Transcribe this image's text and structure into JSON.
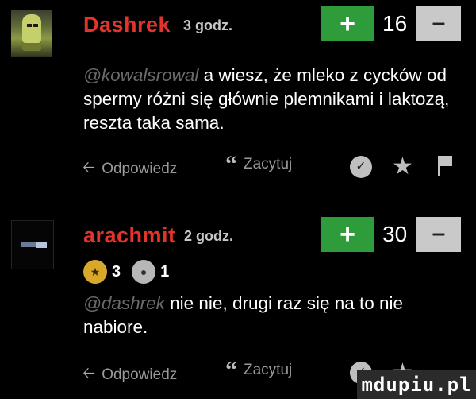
{
  "comments": [
    {
      "username": "Dashrek",
      "time": "3 godz.",
      "plus_label": "+",
      "score": "16",
      "minus_label": "–",
      "mention": "@kowalsrowal",
      "text": " a wiesz, że mleko z cycków od spermy różni się głównie plemnikami i laktozą, reszta taka sama.",
      "actions": {
        "reply_label": "Odpowiedz",
        "quote_label": "Zacytuj",
        "reply_icon": "reply-arrow-icon",
        "quote_icon": "quote-icon",
        "badge_icon": "badge-icon",
        "star_icon": "star-icon",
        "flag_icon": "flag-icon"
      }
    },
    {
      "username": "arachmit",
      "time": "2 godz.",
      "plus_label": "+",
      "score": "30",
      "minus_label": "–",
      "badges": [
        {
          "icon": "gold-badge-icon",
          "count": "3"
        },
        {
          "icon": "grey-badge-icon",
          "count": "1"
        }
      ],
      "mention": "@dashrek",
      "text": " nie nie, drugi raz się na to nie nabiore.",
      "actions": {
        "reply_label": "Odpowiedz",
        "quote_label": "Zacytuj"
      }
    }
  ],
  "colors": {
    "background": "#000000",
    "username": "#e3342b",
    "plus_button": "#2f9c3c",
    "minus_button": "#c9c9c9",
    "mention": "#6b6b6b"
  },
  "watermark": "mdupiu.pl"
}
